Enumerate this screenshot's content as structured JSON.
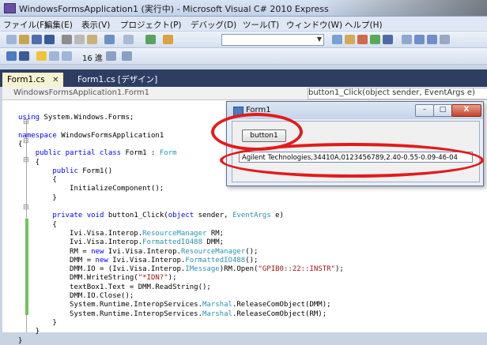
{
  "window": {
    "title": "WindowsFormsApplication1 (実行中) - Microsoft Visual C# 2010 Express"
  },
  "menu": {
    "items": [
      "ファイル(F)",
      "編集(E)",
      "表示(V)",
      "プロジェクト(P)",
      "デバッグ(D)",
      "ツール(T)",
      "ウィンドウ(W)",
      "ヘルプ(H)"
    ]
  },
  "toolbar2": {
    "hex_label": "16 進"
  },
  "tabs": [
    {
      "label": "Form1.cs",
      "active": true
    },
    {
      "label": "Form1.cs [デザイン]",
      "active": false
    }
  ],
  "nav": {
    "left": "WindowsFormsApplication1.Form1",
    "right": "button1_Click(object sender, EventArgs e)"
  },
  "form1": {
    "title": "Form1",
    "button_label": "button1",
    "textbox_value": "Agilent Technologies,34410A,0123456789,2.40-0.55-0.09-46-04"
  },
  "annotation_color": "#e21b1b",
  "code_lines": [
    "using System.Windows.Forms;",
    "",
    "namespace WindowsFormsApplication1",
    "{",
    "    public partial class Form1 : Form",
    "    {",
    "        public Form1()",
    "        {",
    "            InitializeComponent();",
    "        }",
    "",
    "        private void button1_Click(object sender, EventArgs e)",
    "        {",
    "            Ivi.Visa.Interop.ResourceManager RM;",
    "            Ivi.Visa.Interop.FormattedIO488 DMM;",
    "            RM = new Ivi.Visa.Interop.ResourceManager();",
    "            DMM = new Ivi.Visa.Interop.FormattedIO488();",
    "            DMM.IO = (Ivi.Visa.Interop.IMessage)RM.Open(\"GPIB0::22::INSTR\");",
    "            DMM.WriteString(\"*IDN?\");",
    "            textBox1.Text = DMM.ReadString();",
    "            DMM.IO.Close();",
    "            System.Runtime.InteropServices.Marshal.ReleaseComObject(DMM);",
    "            System.Runtime.InteropServices.Marshal.ReleaseComObject(RM);",
    "        }",
    "    }",
    "}"
  ]
}
